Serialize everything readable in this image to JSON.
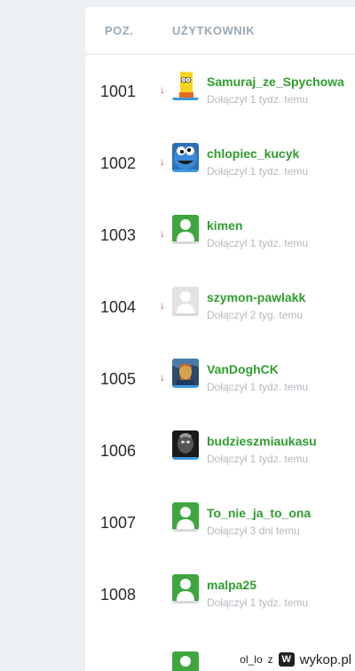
{
  "header": {
    "col_position": "POZ.",
    "col_user": "UŻYTKOWNIK"
  },
  "rows": [
    {
      "rank": "1001",
      "arrow": "↓",
      "username": "Samuraj_ze_Spychowa",
      "joined": "Dołączył 1 tydz. temu",
      "avatar": "bart-avatar-icon"
    },
    {
      "rank": "1002",
      "arrow": "↓",
      "username": "chlopiec_kucyk",
      "joined": "Dołączył 1 tydz. temu",
      "avatar": "cookie-monster-avatar-icon"
    },
    {
      "rank": "1003",
      "arrow": "↓",
      "username": "kimen",
      "joined": "Dołączył 1 tydz. temu",
      "avatar": "default-green-avatar-icon"
    },
    {
      "rank": "1004",
      "arrow": "↓",
      "username": "szymon-pawlakk",
      "joined": "Dołączył 2 tyg. temu",
      "avatar": "default-grey-avatar-icon"
    },
    {
      "rank": "1005",
      "arrow": "↓",
      "username": "VanDoghCK",
      "joined": "Dołączył 1 tydz. temu",
      "avatar": "van-gogh-avatar-icon"
    },
    {
      "rank": "1006",
      "arrow": "",
      "username": "budzieszmiaukasu",
      "joined": "Dołączył 1 tydz. temu",
      "avatar": "dark-photo-avatar-icon"
    },
    {
      "rank": "1007",
      "arrow": "",
      "username": "To_nie_ja_to_ona",
      "joined": "Dołączył 3 dni temu",
      "avatar": "default-green-avatar-icon"
    },
    {
      "rank": "1008",
      "arrow": "",
      "username": "malpa25",
      "joined": "Dołączył 1 tydz. temu",
      "avatar": "default-green-avatar-icon"
    }
  ],
  "footer": {
    "author": "ol_lo",
    "separator": "z",
    "brand": "wykop.pl",
    "logo_letter": "W"
  },
  "colors": {
    "username": "#2f9d2f",
    "arrow_down": "#e0374b",
    "avatar_underline": "#3b9ae1",
    "header_text": "#9aa8b4"
  }
}
